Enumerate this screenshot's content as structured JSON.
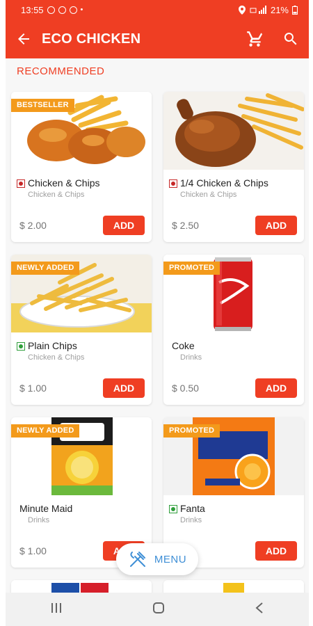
{
  "status_bar": {
    "time": "13:55",
    "battery": "21%",
    "icons": [
      "whatsapp-icon",
      "gmail-icon",
      "notification-icon",
      "location-icon",
      "signal-icon",
      "battery-icon"
    ]
  },
  "app_bar": {
    "title": "ECO CHICKEN",
    "icons": [
      "back-arrow-icon",
      "cart-icon",
      "search-icon"
    ]
  },
  "section": {
    "title": "RECOMMENDED"
  },
  "colors": {
    "primary": "#ef3e23",
    "badge": "#f39a1b",
    "menu_text": "#3f8fd6",
    "nonveg": "#c62828",
    "veg": "#2e9e3a"
  },
  "products": [
    {
      "name": "Chicken & Chips",
      "category": "Chicken & Chips",
      "price": "$ 2.00",
      "badge": "BESTSELLER",
      "mark": "nonveg",
      "add_label": "ADD"
    },
    {
      "name": "1/4 Chicken & Chips",
      "category": "Chicken & Chips",
      "price": "$ 2.50",
      "badge": "",
      "mark": "nonveg",
      "add_label": "ADD"
    },
    {
      "name": "Plain Chips",
      "category": "Chicken & Chips",
      "price": "$ 1.00",
      "badge": "NEWLY ADDED",
      "mark": "veg",
      "add_label": "ADD"
    },
    {
      "name": "Coke",
      "category": "Drinks",
      "price": "$ 0.50",
      "badge": "PROMOTED",
      "mark": "",
      "add_label": "ADD"
    },
    {
      "name": "Minute Maid",
      "category": "Drinks",
      "price": "$ 1.00",
      "badge": "NEWLY ADDED",
      "mark": "",
      "add_label": "ADD"
    },
    {
      "name": "Fanta",
      "category": "Drinks",
      "price": "",
      "badge": "PROMOTED",
      "mark": "veg",
      "add_label": "ADD"
    }
  ],
  "menu_button": {
    "label": "MENU"
  },
  "nav_bar": {
    "icons": [
      "recent-apps-icon",
      "home-icon",
      "back-icon"
    ]
  }
}
